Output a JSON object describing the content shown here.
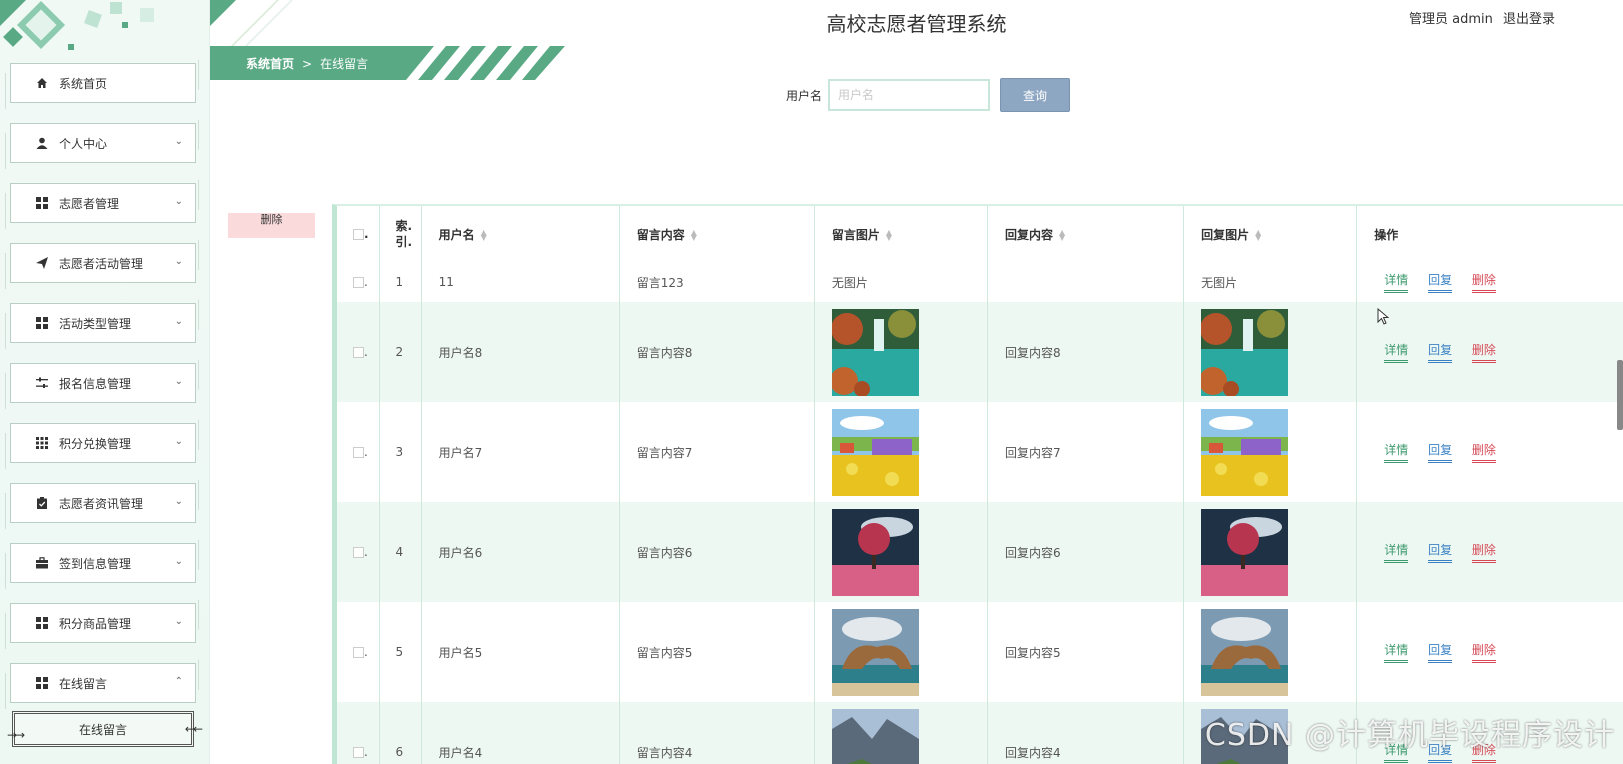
{
  "header": {
    "system_title": "高校志愿者管理系统",
    "user_label": "管理员 admin",
    "logout_label": "退出登录"
  },
  "sidebar": {
    "items": [
      {
        "label": "系统首页",
        "icon": "home-icon"
      },
      {
        "label": "个人中心",
        "icon": "user-icon"
      },
      {
        "label": "志愿者管理",
        "icon": "grid-icon"
      },
      {
        "label": "志愿者活动管理",
        "icon": "send-icon"
      },
      {
        "label": "活动类型管理",
        "icon": "grid-icon"
      },
      {
        "label": "报名信息管理",
        "icon": "sliders-icon"
      },
      {
        "label": "积分兑换管理",
        "icon": "apps-icon"
      },
      {
        "label": "志愿者资讯管理",
        "icon": "clipboard-icon"
      },
      {
        "label": "签到信息管理",
        "icon": "briefcase-icon"
      },
      {
        "label": "积分商品管理",
        "icon": "grid-icon"
      },
      {
        "label": "在线留言",
        "icon": "grid-icon"
      }
    ],
    "submenu_label": "在线留言"
  },
  "breadcrumb": {
    "home": "系统首页",
    "separator": ">",
    "current": "在线留言"
  },
  "search": {
    "label": "用户名",
    "placeholder": "用户名",
    "value": "",
    "button": "查询"
  },
  "batch_delete_label": "删除",
  "table": {
    "headers": {
      "index": "索引",
      "index_line1": "索.",
      "index_line2": "引.",
      "username": "用户名",
      "message": "留言内容",
      "message_image": "留言图片",
      "reply": "回复内容",
      "reply_image": "回复图片",
      "actions": "操作"
    },
    "actions": {
      "detail": "详情",
      "reply": "回复",
      "delete": "删除"
    },
    "rows": [
      {
        "index": "1",
        "username": "11",
        "message": "留言123",
        "message_image": "无图片",
        "reply": "",
        "reply_image": "无图片"
      },
      {
        "index": "2",
        "username": "用户名8",
        "message": "留言内容8",
        "message_image": "waterfall-lake",
        "reply": "回复内容8",
        "reply_image": "waterfall-lake"
      },
      {
        "index": "3",
        "username": "用户名7",
        "message": "留言内容7",
        "message_image": "flower-field",
        "reply": "回复内容7",
        "reply_image": "flower-field"
      },
      {
        "index": "4",
        "username": "用户名6",
        "message": "留言内容6",
        "message_image": "pink-tree",
        "reply": "回复内容6",
        "reply_image": "pink-tree"
      },
      {
        "index": "5",
        "username": "用户名5",
        "message": "留言内容5",
        "message_image": "sea-arch",
        "reply": "回复内容5",
        "reply_image": "sea-arch"
      },
      {
        "index": "6",
        "username": "用户名4",
        "message": "留言内容4",
        "message_image": "mountain-cliff",
        "reply": "回复内容4",
        "reply_image": "mountain-cliff"
      }
    ]
  },
  "watermark": "CSDN @计算机毕设程序设计",
  "colors": {
    "accent_green": "#5aa985",
    "sidebar_bg": "#eef8f3",
    "row_alt": "#eef8f3",
    "detail": "#3d9a6e",
    "reply": "#3b82c4",
    "delete": "#d54a55",
    "query_button": "#8da6c2"
  }
}
